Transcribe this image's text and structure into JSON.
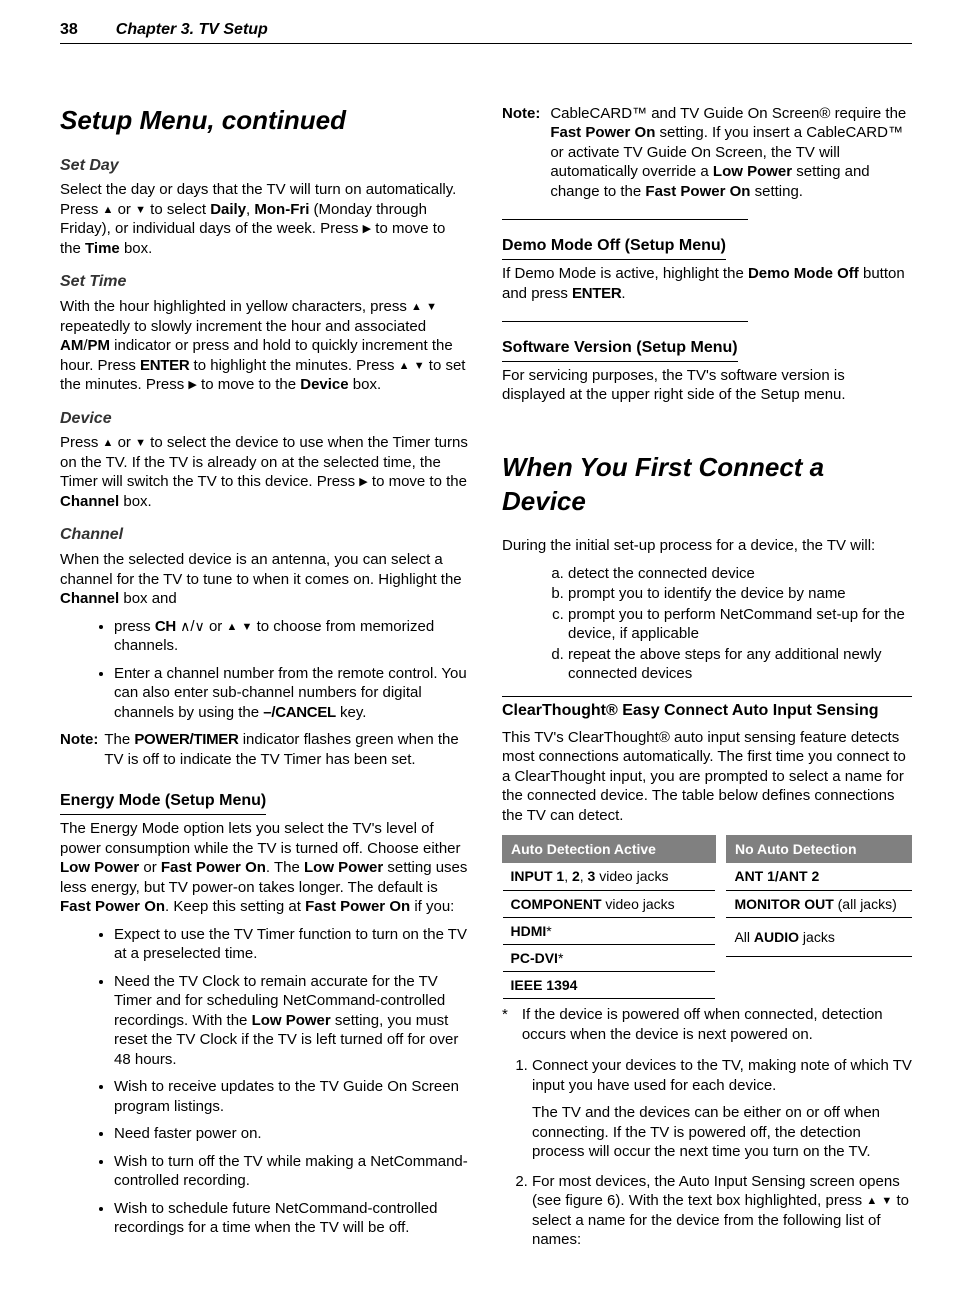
{
  "header": {
    "page": "38",
    "chapter": "Chapter 3.  TV Setup"
  },
  "left": {
    "h1": "Setup Menu, continued",
    "setday_h": "Set Day",
    "setday_p0a": "Select the day or days that the TV will turn on automatically.  Press ",
    "setday_p0b": " or ",
    "setday_p0c": " to select ",
    "setday_b1": "Daily",
    "setday_p0d": ", ",
    "setday_b2": "Mon-Fri",
    "setday_p0e": " (Monday through Friday), or individual days of the week.  Press ",
    "setday_p0f": " to move to the ",
    "setday_b3": "Time",
    "setday_p0g": " box.",
    "settime_h": "Set Time",
    "settime_p0a": "With the hour highlighted in yellow characters, press ",
    "settime_p0b": " repeatedly to slowly increment the hour and associated ",
    "settime_b1": "AM",
    "settime_p0c": "/",
    "settime_b2": "PM",
    "settime_p0d": " indicator or press and hold to quickly increment the hour.  Press ",
    "settime_k1": "ENTER",
    "settime_p0e": " to highlight the minutes.  Press ",
    "settime_p0f": " to set the minutes.  Press ",
    "settime_p0g": " to move to the ",
    "settime_b3": "Device",
    "settime_p0h": " box.",
    "device_h": "Device",
    "device_p0a": "Press ",
    "device_p0b": " or ",
    "device_p0c": " to select the device to use when the Timer turns on the TV.  If the TV is already on at the selected time, the Timer will switch the TV to this device.  Press ",
    "device_p0d": " to move to the ",
    "device_b1": "Channel",
    "device_p0e": " box.",
    "channel_h": "Channel",
    "channel_p0a": "When the selected device is an antenna, you can select a channel for the TV to tune to when it comes on.  Highlight the ",
    "channel_b1": "Channel",
    "channel_p0b": " box and",
    "channel_li1a": "press ",
    "channel_li1_ch": "CH",
    "channel_li1b": " or ",
    "channel_li1c": " to choose from memorized channels.",
    "channel_li2a": "Enter a channel number from the remote control.  You can also enter sub-channel numbers for digital channels by using the ",
    "channel_li2_k": "–/CANCEL",
    "channel_li2b": " key.",
    "note1_label": "Note:",
    "note1_a": "The ",
    "note1_k": "POWER/TIMER",
    "note1_b": " indicator flashes green when the TV is off to indicate the TV Timer has been set.",
    "energy_h": "Energy Mode (Setup Menu)",
    "energy_p1a": "The Energy Mode option lets you select the TV's level of power consumption while the TV is turned off.  Choose either ",
    "energy_b1": "Low Power",
    "energy_p1b": " or ",
    "energy_b2": "Fast Power On",
    "energy_p1c": ".  The ",
    "energy_b3": "Low Power",
    "energy_p1d": " setting uses less energy, but TV power-on takes longer.  The default is ",
    "energy_b4": "Fast Power On",
    "energy_p1e": ".  Keep this setting at ",
    "energy_b5": "Fast Power On",
    "energy_p1f": " if you:",
    "energy_li1": "Expect to use the TV Timer function to turn on the TV at a preselected time.",
    "energy_li2a": "Need the TV Clock to remain accurate for the TV Timer and for scheduling NetCommand-controlled recordings.  With the ",
    "energy_li2b": "Low Power",
    "energy_li2c": " setting, you must reset the TV Clock if the TV is left turned off for over 48 hours.",
    "energy_li3": "Wish to receive updates to the TV Guide On Screen program listings.",
    "energy_li4": "Need faster power on.",
    "energy_li5": "Wish to turn off the TV while making a NetCommand-controlled recording.",
    "energy_li6": "Wish to schedule future NetCommand-controlled recordings for a time when the TV will be off."
  },
  "right": {
    "note_label": "Note:",
    "note_a": "CableCARD™ and TV Guide On Screen® require the ",
    "note_b1": "Fast Power On",
    "note_b": " setting.  If you insert a CableCARD™ or activate TV Guide On Screen, the TV will automatically override a ",
    "note_b2": "Low Power",
    "note_c": " setting and change to the ",
    "note_b3": "Fast Power On",
    "note_d": " setting.",
    "demo_h": "Demo Mode Off (Setup Menu)",
    "demo_p_a": "If Demo Mode is active, highlight the ",
    "demo_p_b": "Demo Mode Off",
    "demo_p_c": " button and press ",
    "demo_p_k": "ENTER",
    "demo_p_d": ".",
    "sw_h": "Software Version (Setup Menu)",
    "sw_p": "For servicing purposes, the TV's software version is displayed at the upper right side of the Setup menu.",
    "h1": "When You First Connect a Device",
    "intro": "During the initial set-up process for a device, the TV will:",
    "li_a": "detect the connected device",
    "li_b": "prompt you to identify the device by name",
    "li_c": "prompt you to perform NetCommand set-up for the device, if applicable",
    "li_d": "repeat the above steps for any additional newly connected devices",
    "ct_h": "ClearThought® Easy Connect Auto Input Sensing",
    "ct_p": "This TV's ClearThought® auto input sensing feature detects most connections automatically.  The first time you connect to a ClearThought input, you are prompted to select a name for the connected device.  The table below defines connections the TV can detect.",
    "t1_h": "Auto Detection Active",
    "t1_r1a": "INPUT 1",
    "t1_r1b": ", ",
    "t1_r1c": "2",
    "t1_r1d": ", ",
    "t1_r1e": "3",
    "t1_r1f": " video jacks",
    "t1_r2a": "COMPONENT",
    "t1_r2b": "  video jacks",
    "t1_r3a": "HDMI",
    "t1_r3b": "*",
    "t1_r4a": "PC-DVI",
    "t1_r4b": "*",
    "t1_r5": "IEEE 1394",
    "t2_h": "No Auto Detection",
    "t2_r1": "ANT 1/ANT 2",
    "t2_r2a": "MONITOR OUT",
    "t2_r2b": " (all jacks)",
    "t2_r3a": "All ",
    "t2_r3b": "AUDIO",
    "t2_r3c": " jacks",
    "ast": "*",
    "ast_txt": "If the device is powered off when connected, detection occurs when the device is next powered on.",
    "ol1a": "Connect your devices to the TV, making note of which TV input you have used for each device.",
    "ol1b": "The TV and the devices can be either on or off when connecting.  If the TV is powered off, the detection process will occur the next time you turn on the TV.",
    "ol2a": "For most devices, the Auto Input Sensing screen opens (see figure 6).  With the text box highlighted, press  ",
    "ol2b": " to select a name for the device from the following list of names:"
  }
}
